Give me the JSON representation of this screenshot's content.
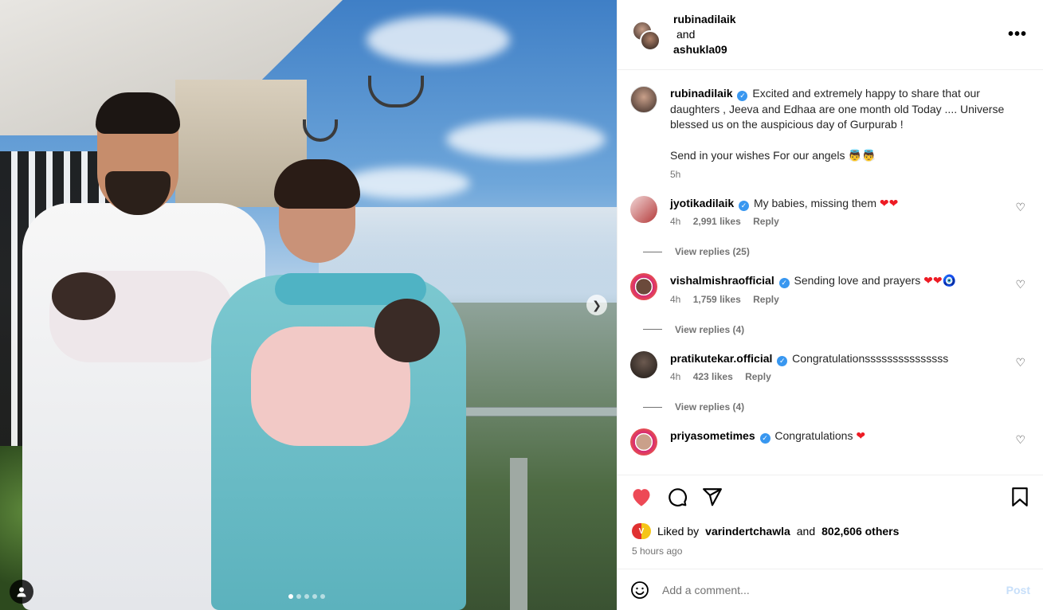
{
  "post_header": {
    "user1": "rubinadilaik",
    "and": "and",
    "user2": "ashukla09",
    "more_icon": "more-horizontal-icon"
  },
  "caption": {
    "username": "rubinadilaik",
    "line1": "Excited and extremely happy to share that our daughters , Jeeva and Edhaa are one month old Today .... Universe blessed us on the auspicious day of Gurpurab !",
    "line2": "Send in your wishes For our angels 👼👼",
    "time": "5h"
  },
  "comments": [
    {
      "username": "jyotikadilaik",
      "text": "My babies, missing them",
      "emoji": "❤❤",
      "time": "4h",
      "likes": "2,991 likes",
      "reply": "Reply",
      "view_replies": "View replies (25)"
    },
    {
      "username": "vishalmishraofficial",
      "text": "Sending love and prayers",
      "emoji": "❤❤🧿",
      "time": "4h",
      "likes": "1,759 likes",
      "reply": "Reply",
      "view_replies": "View replies (4)"
    },
    {
      "username": "pratikutekar.official",
      "text": "Congratulationsssssssssssssss",
      "emoji": "",
      "time": "4h",
      "likes": "423 likes",
      "reply": "Reply",
      "view_replies": "View replies (4)"
    },
    {
      "username": "priyasometimes",
      "text": "Congratulations",
      "emoji": "❤",
      "time": "",
      "likes": "",
      "reply": "",
      "view_replies": ""
    }
  ],
  "likes": {
    "prefix": "Liked by",
    "user": "varindertchawla",
    "mid": "and",
    "others": "802,606 others",
    "badge": "V"
  },
  "timestamp": "5 hours ago",
  "add_comment": {
    "placeholder": "Add a comment...",
    "post": "Post"
  },
  "colors": {
    "like_red": "#ed4956",
    "verified_blue": "#3897f0",
    "muted": "#737373"
  }
}
